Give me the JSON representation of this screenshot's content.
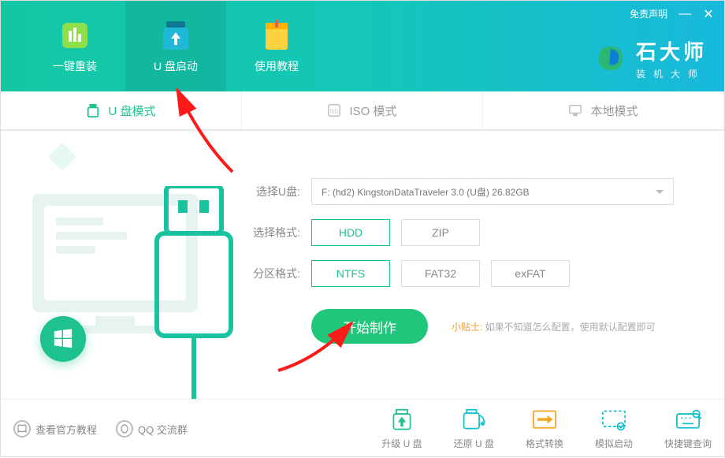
{
  "window": {
    "disclaimer": "免责声明"
  },
  "brand": {
    "title": "石大师",
    "sub": "装机大师"
  },
  "nav": {
    "reinstall": "一键重装",
    "usbboot": "U 盘启动",
    "tutorial": "使用教程"
  },
  "modes": {
    "usb": "U 盘模式",
    "iso": "ISO 模式",
    "local": "本地模式"
  },
  "form": {
    "select_usb_label": "选择U盘:",
    "select_usb_value": "F: (hd2) KingstonDataTraveler 3.0 (U盘) 26.82GB",
    "select_format_label": "选择格式:",
    "format_options": [
      "HDD",
      "ZIP"
    ],
    "partition_label": "分区格式:",
    "partition_options": [
      "NTFS",
      "FAT32",
      "exFAT"
    ]
  },
  "action": {
    "start": "开始制作",
    "tip_label": "小贴士:",
    "tip_text": " 如果不知道怎么配置，使用默认配置即可"
  },
  "footer_links": {
    "official": "查看官方教程",
    "qq": "QQ 交流群"
  },
  "tools": {
    "upgrade": "升级 U 盘",
    "restore": "还原 U 盘",
    "convert": "格式转换",
    "simulate": "模拟启动",
    "hotkey": "快捷键查询"
  }
}
